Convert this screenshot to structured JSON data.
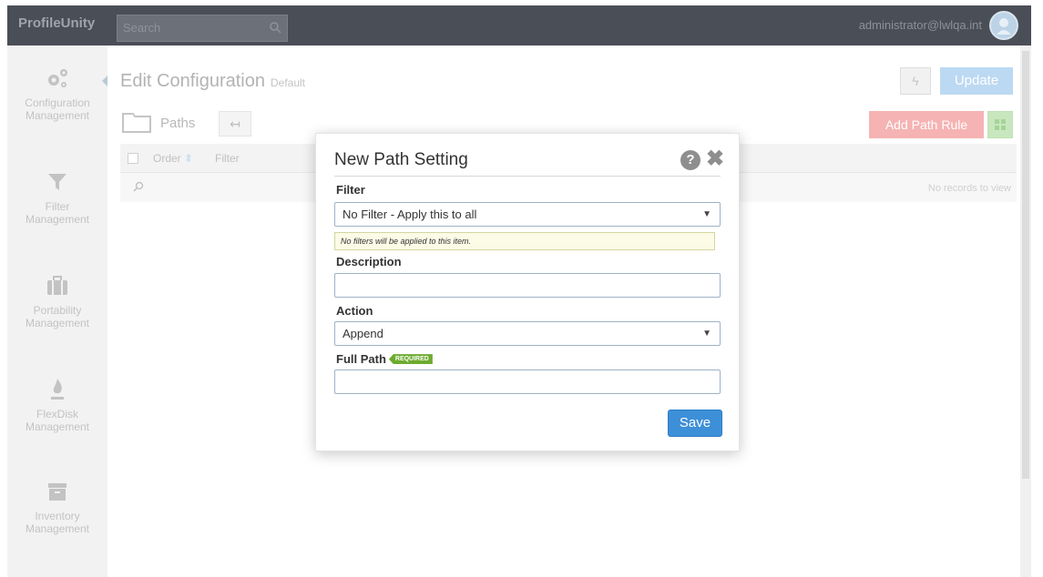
{
  "app": {
    "brand": "ProfileUnity"
  },
  "search": {
    "placeholder": "Search"
  },
  "user": {
    "name": "administrator@lwlqa.int"
  },
  "sidebar": {
    "items": [
      {
        "label_line1": "Configuration",
        "label_line2": "Management",
        "icon": "gears-icon"
      },
      {
        "label_line1": "Filter",
        "label_line2": "Management",
        "icon": "funnel-icon"
      },
      {
        "label_line1": "Portability",
        "label_line2": "Management",
        "icon": "briefcase-icon"
      },
      {
        "label_line1": "FlexDisk",
        "label_line2": "Management",
        "icon": "flame-icon"
      },
      {
        "label_line1": "Inventory",
        "label_line2": "Management",
        "icon": "archive-icon"
      }
    ]
  },
  "main": {
    "title": "Edit Configuration",
    "subtitle": "Default",
    "update_label": "Update",
    "flash_label": "ϟ",
    "section_label": "Paths",
    "back_label": "↤",
    "add_rule_label": "Add Path Rule",
    "table": {
      "columns": [
        "Order",
        "Filter"
      ],
      "empty_text": "No records to view"
    }
  },
  "modal": {
    "title": "New Path Setting",
    "help_label": "?",
    "close_label": "✖",
    "filter": {
      "label": "Filter",
      "value": "No Filter - Apply this to all",
      "hint": "No filters will be applied to this item."
    },
    "description": {
      "label": "Description",
      "value": ""
    },
    "action": {
      "label": "Action",
      "value": "Append"
    },
    "full_path": {
      "label": "Full Path",
      "badge": "REQUIRED",
      "value": ""
    },
    "save_label": "Save"
  },
  "colors": {
    "topbar": "#4a4e56",
    "sidebar": "#f2f2f2",
    "primary": "#3d8fd8",
    "danger_faded": "#f6b3b3",
    "required_badge": "#6dab2f",
    "hint_bg": "#fbfbe6"
  }
}
